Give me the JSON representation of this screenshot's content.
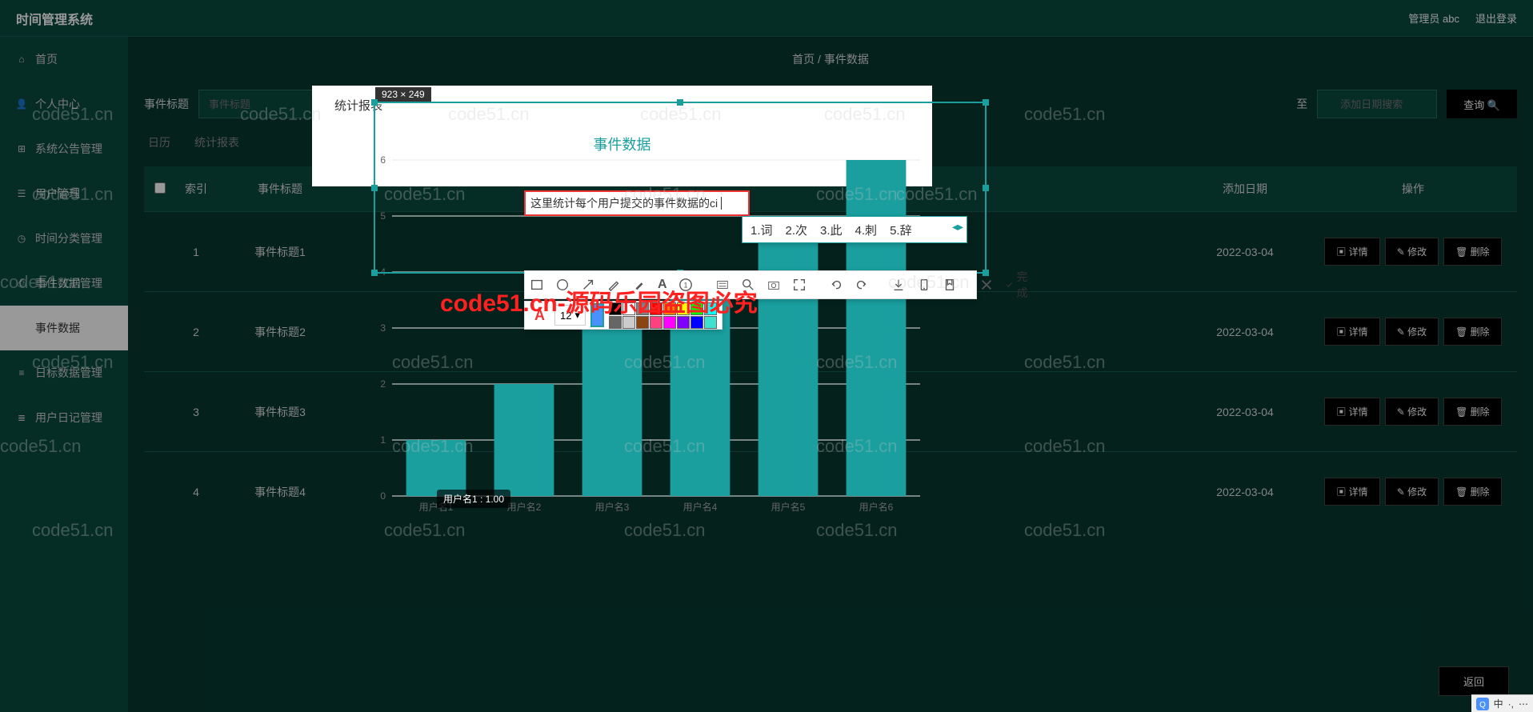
{
  "app_title": "时间管理系统",
  "header": {
    "admin": "管理员 abc",
    "logout": "退出登录"
  },
  "sidebar": {
    "items": [
      {
        "icon": "home",
        "label": "首页"
      },
      {
        "icon": "user",
        "label": "个人中心"
      },
      {
        "icon": "grid",
        "label": "系统公告管理"
      },
      {
        "icon": "users",
        "label": "用户管理"
      },
      {
        "icon": "clock",
        "label": "时间分类管理"
      },
      {
        "icon": "doc",
        "label": "事件数据管理"
      },
      {
        "icon": "data",
        "label": "事件数据",
        "active": true
      },
      {
        "icon": "bars",
        "label": "日标数据管理"
      },
      {
        "icon": "diary",
        "label": "用户日记管理"
      }
    ]
  },
  "breadcrumb": {
    "home": "首页",
    "sep": "/",
    "current": "事件数据"
  },
  "filter": {
    "label_title": "事件标题",
    "ph_title": "事件标题",
    "label_to": "至",
    "ph_date": "添加日期搜索",
    "btn_search": "查询 🔍"
  },
  "tabs": {
    "calendar": "日历",
    "report": "统计报表"
  },
  "table": {
    "headers": {
      "idx": "索引",
      "title": "事件标题",
      "date": "添加日期",
      "ops": "操作"
    },
    "row_btns": {
      "detail": "▣ 详情",
      "edit": "✎ 修改",
      "delete": "🗑 删除"
    },
    "rows": [
      {
        "idx": "1",
        "title": "事件标题1",
        "date": "2022-03-04"
      },
      {
        "idx": "2",
        "title": "事件标题2",
        "date": "2022-03-04"
      },
      {
        "idx": "3",
        "title": "事件标题3",
        "date": "2022-03-04"
      },
      {
        "idx": "4",
        "title": "事件标题4",
        "date": "2022-03-04"
      }
    ]
  },
  "return_btn": "返回",
  "modal": {
    "title": "统计报表",
    "heading": "事件数据",
    "selection_dims": "923 × 249",
    "annotation_text": "这里统计每个用户提交的事件数据的ci"
  },
  "ime": {
    "candidates": [
      "1.词",
      "2.次",
      "3.此",
      "4.刺",
      "5.辞"
    ]
  },
  "shot_toolbar": {
    "done": "完成",
    "tools": [
      "rect",
      "circle",
      "arrow",
      "pen",
      "marker",
      "text",
      "num",
      "blur",
      "magnify",
      "capture",
      "expand",
      "undo",
      "redo",
      "download",
      "phone",
      "pin",
      "close",
      "check"
    ]
  },
  "font_toolbar": {
    "size": "12",
    "current_color": "#4a90ff",
    "colors": [
      "#000000",
      "#ffffff",
      "#808080",
      "#ff0000",
      "#ff8000",
      "#ffff00",
      "#00ff00",
      "#00ffff",
      "#666666",
      "#cccccc",
      "#8b4513",
      "#ff4080",
      "#ff00ff",
      "#8000ff",
      "#0000ff",
      "#40e0d0"
    ]
  },
  "chart_data": {
    "type": "bar",
    "title": "事件数据",
    "categories": [
      "用户名1",
      "用户名2",
      "用户名3",
      "用户名4",
      "用户名5",
      "用户名6"
    ],
    "values": [
      1,
      2,
      3,
      4,
      5,
      6
    ],
    "ylabel": "",
    "ylim": [
      0,
      6
    ],
    "yticks": [
      0,
      1,
      2,
      3,
      4,
      5,
      6
    ],
    "bar_color": "#1a9e9e",
    "tooltip": "用户名1 : 1.00"
  },
  "watermark_red": "code51.cn-源码乐园盗图必究",
  "watermark_grey": "code51.cn",
  "taskbar": {
    "ime": "中",
    "punct": "·,"
  }
}
